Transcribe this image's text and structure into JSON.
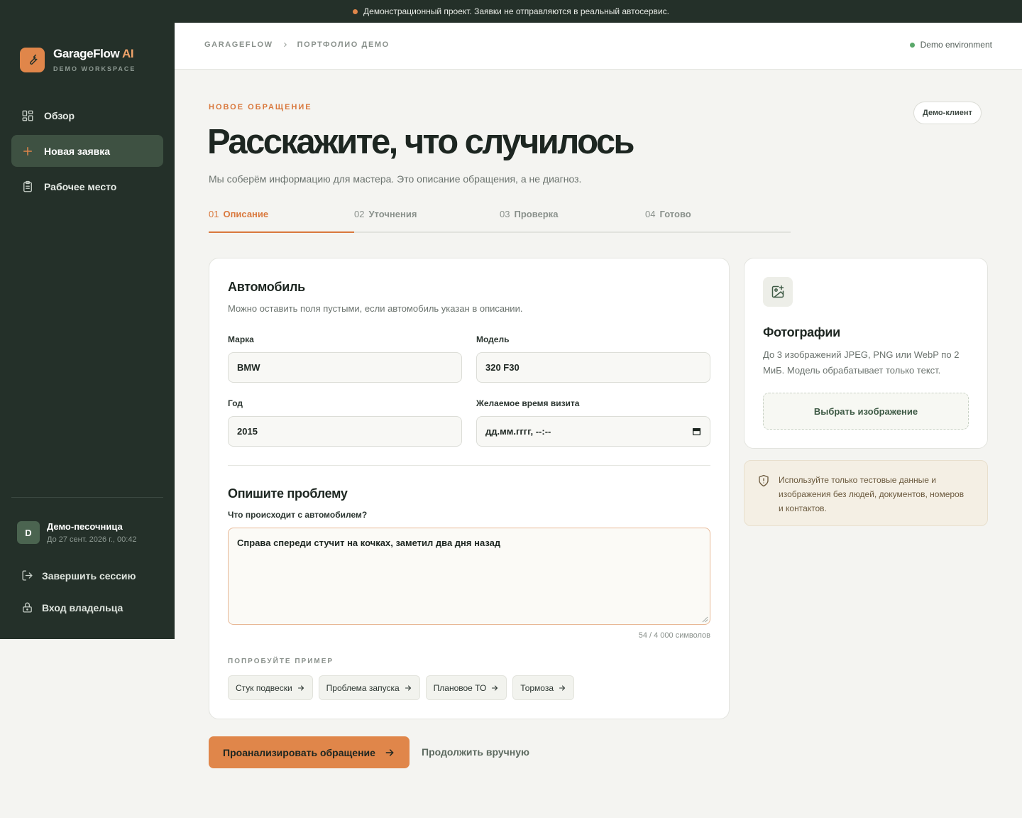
{
  "banner": {
    "text": "Демонстрационный проект. Заявки не отправляются в реальный автосервис."
  },
  "brand": {
    "name": "GarageFlow",
    "name_accent": "AI",
    "workspace": "DEMO WORKSPACE"
  },
  "sidebar": {
    "items": [
      {
        "label": "Обзор",
        "icon": "grid-icon",
        "active": false
      },
      {
        "label": "Новая заявка",
        "icon": "plus-icon",
        "active": true
      },
      {
        "label": "Рабочее место",
        "icon": "clipboard-icon",
        "active": false
      }
    ],
    "user": {
      "initial": "D",
      "name": "Демо-песочница",
      "expires": "До 27 сент. 2026 г., 00:42"
    },
    "logout_label": "Завершить сессию",
    "owner_login_label": "Вход владельца"
  },
  "header": {
    "breadcrumb": [
      "GARAGEFLOW",
      "ПОРТФОЛИО ДЕМО"
    ],
    "environment": "Demo environment"
  },
  "page": {
    "eyebrow": "НОВОЕ ОБРАЩЕНИЕ",
    "title": "Расскажите, что случилось",
    "subtitle": "Мы соберём информацию для мастера. Это описание обращения, а не диагноз.",
    "demo_badge": "Демо-клиент"
  },
  "steps": [
    {
      "num": "01",
      "label": "Описание",
      "active": true
    },
    {
      "num": "02",
      "label": "Уточнения",
      "active": false
    },
    {
      "num": "03",
      "label": "Проверка",
      "active": false
    },
    {
      "num": "04",
      "label": "Готово",
      "active": false
    }
  ],
  "car": {
    "title": "Автомобиль",
    "subtitle": "Можно оставить поля пустыми, если автомобиль указан в описании.",
    "make": {
      "label": "Марка",
      "value": "BMW"
    },
    "model": {
      "label": "Модель",
      "value": "320 F30"
    },
    "year": {
      "label": "Год",
      "value": "2015"
    },
    "visit_time": {
      "label": "Желаемое время визита",
      "placeholder": "дд.мм.гггг, --:--"
    }
  },
  "problem": {
    "title": "Опишите проблему",
    "question": "Что происходит с автомобилем?",
    "value": "Справа спереди стучит на кочках, заметил два дня назад",
    "counter": "54 / 4 000 символов",
    "examples_label": "ПОПРОБУЙТЕ ПРИМЕР",
    "examples": [
      "Стук подвески",
      "Проблема запуска",
      "Плановое ТО",
      "Тормоза"
    ]
  },
  "photos": {
    "title": "Фотографии",
    "description": "До 3 изображений JPEG, PNG или WebP по 2 МиБ. Модель обрабатывает только текст.",
    "button": "Выбрать изображение"
  },
  "notice": {
    "text": "Используйте только тестовые данные и изображения без людей, документов, номеров и контактов."
  },
  "actions": {
    "analyze": "Проанализировать обращение",
    "manual": "Продолжить вручную"
  },
  "colors": {
    "accent": "#e0864a",
    "sidebar": "#243029",
    "active_nav": "#3e5142",
    "status_green": "#5aa86a"
  }
}
